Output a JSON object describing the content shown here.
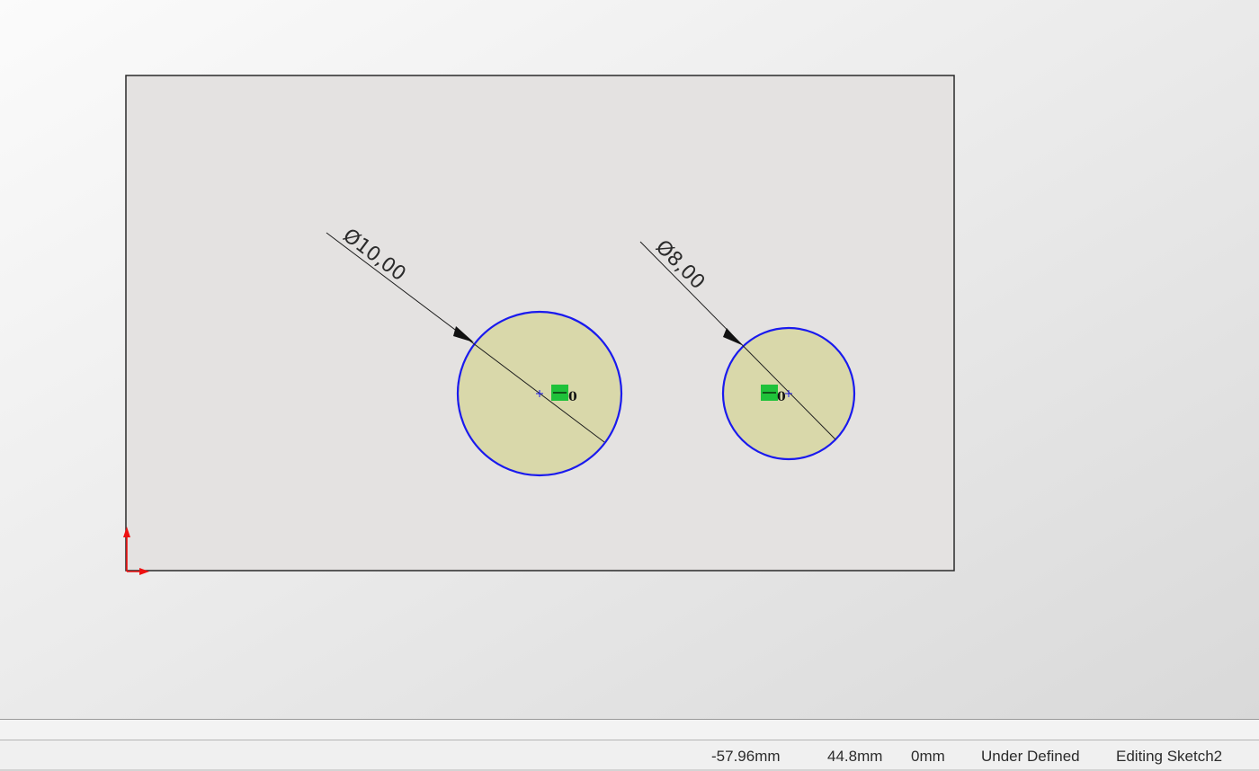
{
  "dimensions": {
    "large": {
      "symbol": "Ø",
      "value": "10,00"
    },
    "small": {
      "symbol": "Ø",
      "value": "8,00"
    }
  },
  "relations": {
    "large_label": "0",
    "small_label": "0"
  },
  "status_bar": {
    "x_coord": "-57.96mm",
    "y_coord": "44.8mm",
    "z_coord": "0mm",
    "sketch_state": "Under Defined",
    "editing": "Editing Sketch2"
  },
  "colors": {
    "sketch_entity": "#1a1aee",
    "hole_fill": "#d9d8aa",
    "relation_badge": "#1fc23a",
    "origin": "#ee1111"
  }
}
